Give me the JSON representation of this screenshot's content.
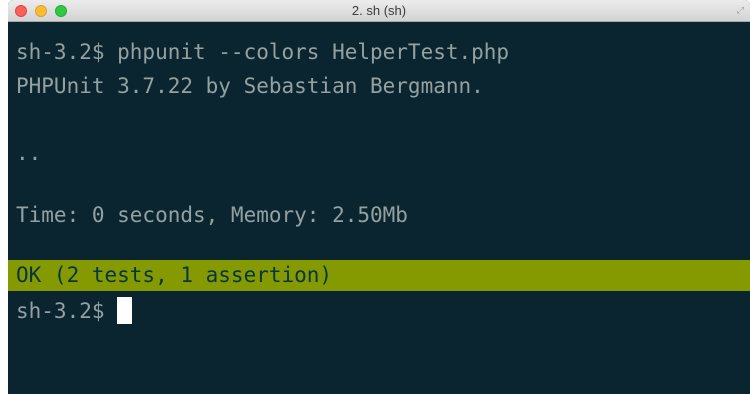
{
  "window": {
    "title": "2. sh (sh)",
    "fullscreen_icon": "fullscreen-icon"
  },
  "terminal": {
    "lines": [
      "sh-3.2$ phpunit --colors HelperTest.php",
      "PHPUnit 3.7.22 by Sebastian Bergmann.",
      "..",
      "Time: 0 seconds, Memory: 2.50Mb"
    ],
    "result": "OK (2 tests, 1 assertion)",
    "prompt": "sh-3.2$"
  },
  "colors": {
    "background": "#0b2530",
    "text": "#93a1a1",
    "ok_bar": "#859900",
    "ok_text": "#073642",
    "cursor": "#ffffff"
  }
}
